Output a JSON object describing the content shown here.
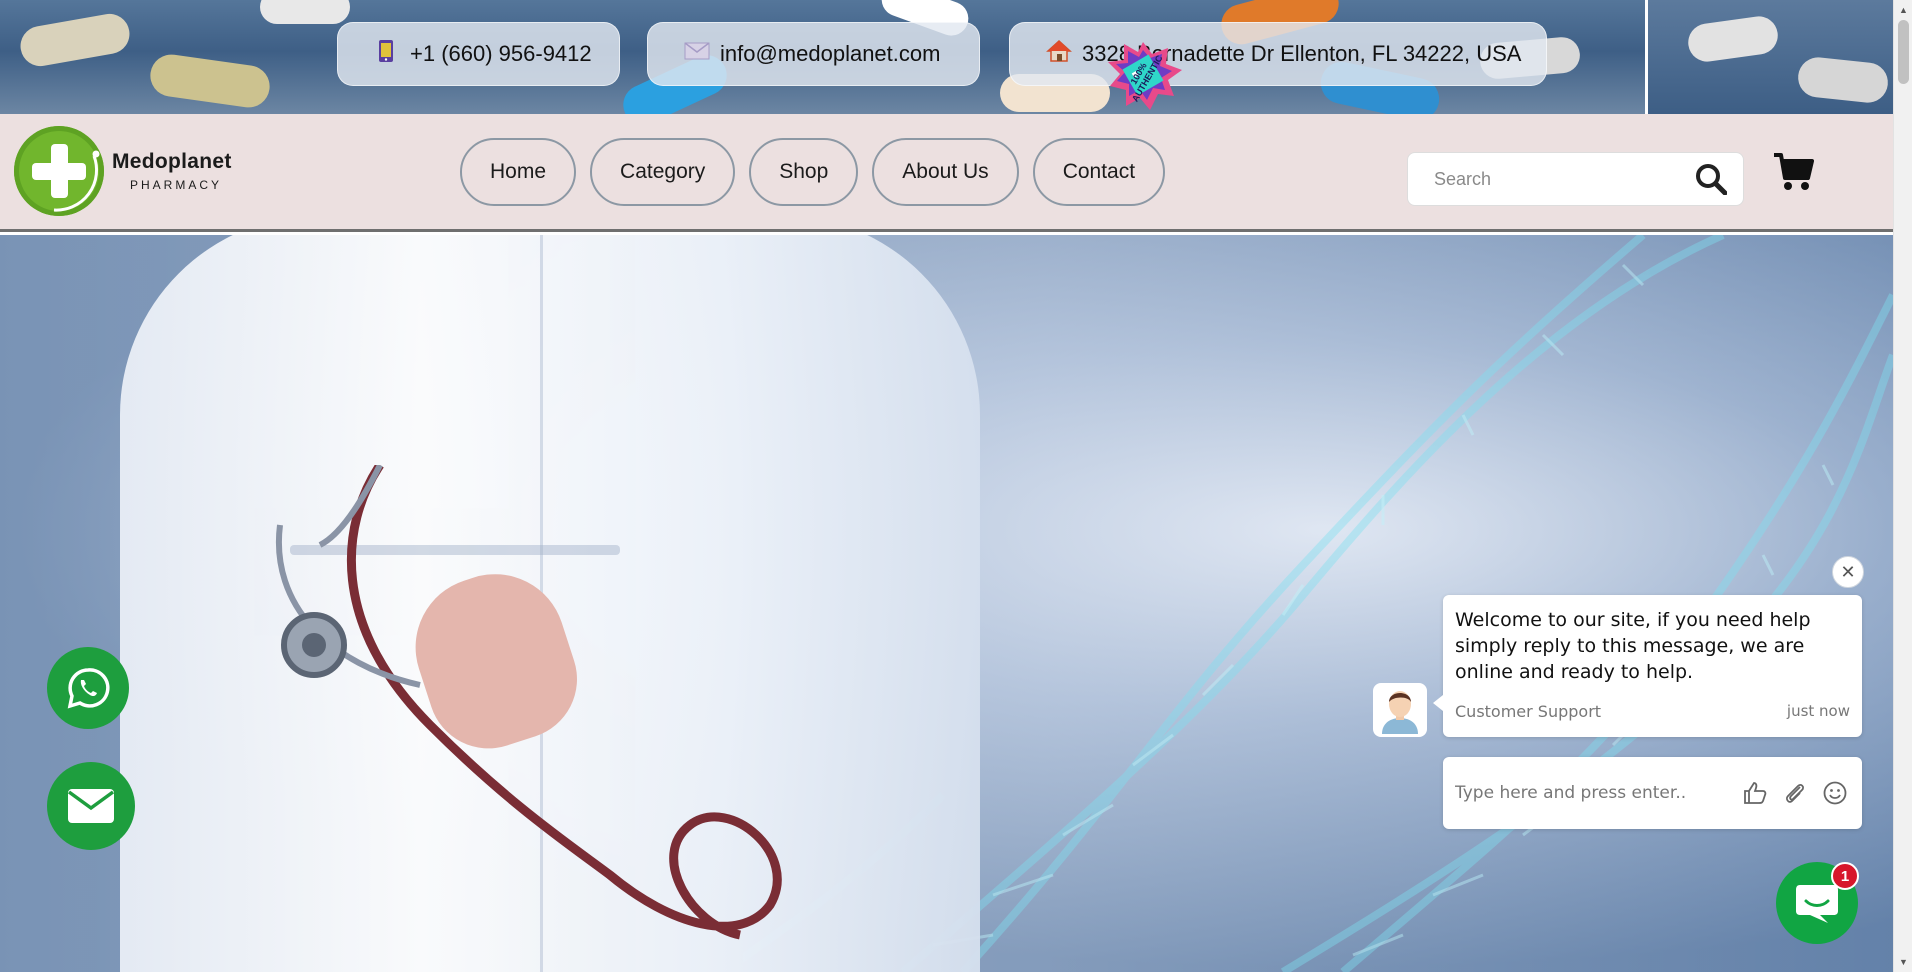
{
  "contacts": {
    "phone": "+1 (660) 956-9412",
    "email": "info@medoplanet.com",
    "address": "3328 Bernadette Dr Ellenton, FL 34222, USA",
    "phone_icon": "mobile-phone-icon",
    "email_icon": "envelope-icon",
    "address_icon": "house-icon",
    "badge_text": "100% AUTHENTIC"
  },
  "logo": {
    "name": "Medoplanet",
    "sub": "PHARMACY",
    "color": "#71b62d"
  },
  "nav": {
    "items": [
      {
        "label": "Home"
      },
      {
        "label": "Category"
      },
      {
        "label": "Shop"
      },
      {
        "label": "About Us"
      },
      {
        "label": "Contact"
      }
    ]
  },
  "search": {
    "placeholder": "Search",
    "value": ""
  },
  "cart": {
    "icon": "shopping-cart-icon"
  },
  "floating": {
    "whatsapp_icon": "whatsapp-icon",
    "email_icon": "envelope-icon",
    "color": "#1e9e3e"
  },
  "chat": {
    "message": "Welcome to our site, if you need help simply reply to this message, we are online and ready to help.",
    "sender": "Customer Support",
    "time": "just now",
    "input_placeholder": "Type here and press enter..",
    "badge_count": "1",
    "launcher_color": "#11a543",
    "badge_color": "#d7162b"
  }
}
